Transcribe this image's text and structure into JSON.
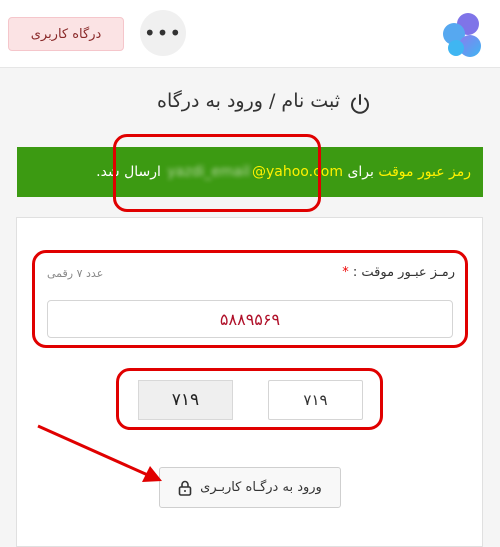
{
  "header": {
    "portal_button_label": "درگاه کاربری",
    "more_label": "•••",
    "logo_icon": "logo-icon"
  },
  "page": {
    "title": "ثبت نام / ورود به درگاه",
    "title_icon": "power-icon"
  },
  "alert": {
    "text_start": "رمز عبور موقت",
    "text_for": "برای",
    "email_hidden": "yazdi_email",
    "email_domain": "@yahoo.com",
    "text_end": "ارسال شد."
  },
  "form": {
    "code_label": "رمـز عبـور موقت :",
    "required_mark": "*",
    "code_hint": "عدد ۷ رقمی",
    "code_value": "۵۸۸۹۵۶۹",
    "captcha_image_text": "۷۱۹",
    "captcha_value": "۷۱۹",
    "login_button_label": "ورود به درگـاه کاربـری",
    "login_icon": "lock-icon"
  },
  "colors": {
    "alert_bg": "#3c9a12",
    "highlight": "#fff200",
    "annotation": "#e00000",
    "code_text": "#b0112a"
  }
}
